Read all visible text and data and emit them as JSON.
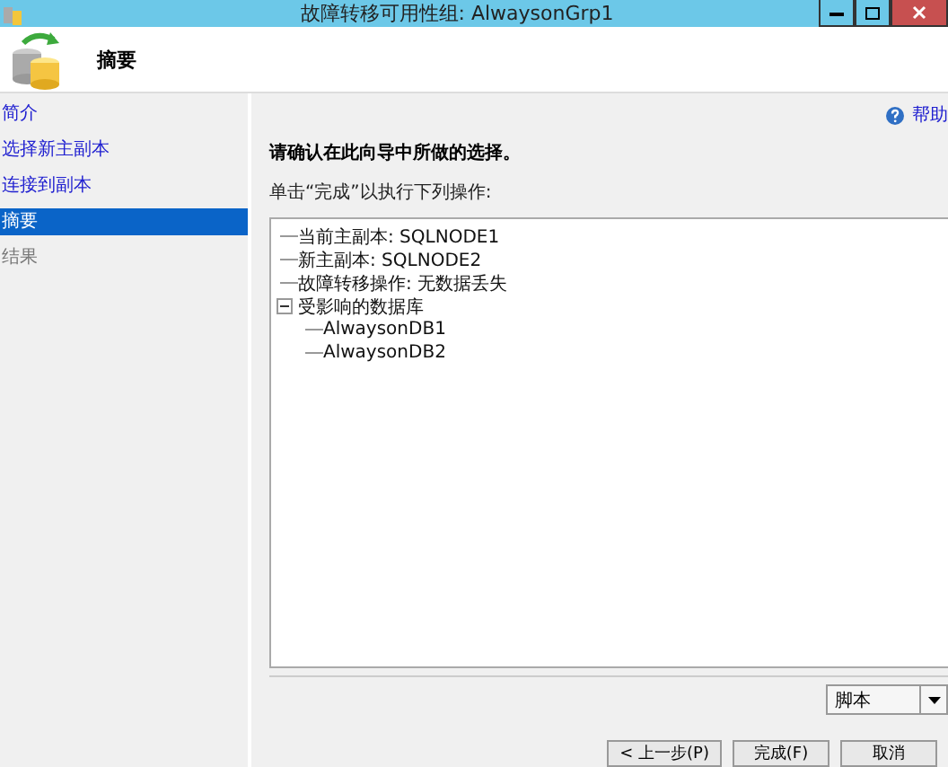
{
  "window": {
    "title": "故障转移可用性组: AlwaysonGrp1"
  },
  "header": {
    "title": "摘要"
  },
  "sidebar": {
    "items": [
      {
        "label": "简介",
        "selected": false,
        "disabled": false
      },
      {
        "label": "选择新主副本",
        "selected": false,
        "disabled": false
      },
      {
        "label": "连接到副本",
        "selected": false,
        "disabled": false
      },
      {
        "label": "摘要",
        "selected": true,
        "disabled": false
      },
      {
        "label": "结果",
        "selected": false,
        "disabled": true
      }
    ]
  },
  "help": {
    "label": "帮助"
  },
  "heading": "请确认在此向导中所做的选择。",
  "instruction": "单击“完成”以执行下列操作:",
  "tree": [
    {
      "label": "当前主副本: SQLNODE1"
    },
    {
      "label": "新主副本: SQLNODE2"
    },
    {
      "label": "故障转移操作: 无数据丢失"
    },
    {
      "label": "受影响的数据库",
      "expanded": true,
      "children": [
        {
          "label": "AlwaysonDB1"
        },
        {
          "label": "AlwaysonDB2"
        }
      ]
    }
  ],
  "script_dropdown": {
    "value": "脚本"
  },
  "buttons": [
    {
      "label": "< 上一步(P)"
    },
    {
      "label": "完成(F)"
    },
    {
      "label": "取消"
    }
  ]
}
